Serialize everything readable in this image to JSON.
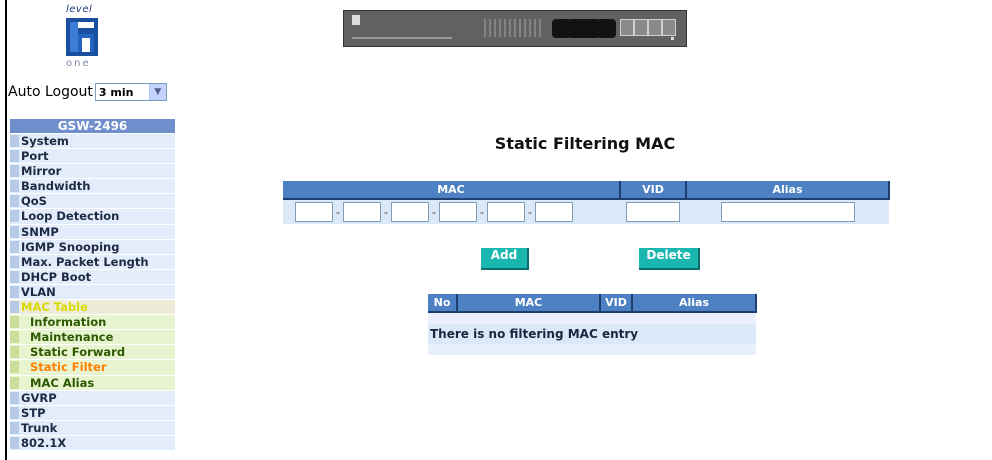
{
  "brand": {
    "top_text": "level",
    "bottom_text": "one"
  },
  "auto_logout": {
    "label": "Auto Logout",
    "value": "3 min"
  },
  "menu": {
    "title": "GSW-2496",
    "items": [
      {
        "label": "System"
      },
      {
        "label": "Port"
      },
      {
        "label": "Mirror"
      },
      {
        "label": "Bandwidth"
      },
      {
        "label": "QoS"
      },
      {
        "label": "Loop Detection"
      },
      {
        "label": "SNMP"
      },
      {
        "label": "IGMP Snooping"
      },
      {
        "label": "Max. Packet Length"
      },
      {
        "label": "DHCP Boot"
      },
      {
        "label": "VLAN"
      },
      {
        "label": "MAC Table"
      },
      {
        "label": "Information"
      },
      {
        "label": "Maintenance"
      },
      {
        "label": "Static Forward"
      },
      {
        "label": "Static Filter"
      },
      {
        "label": "MAC Alias"
      },
      {
        "label": "GVRP"
      },
      {
        "label": "STP"
      },
      {
        "label": "Trunk"
      },
      {
        "label": "802.1X"
      }
    ]
  },
  "main": {
    "title": "Static Filtering MAC",
    "entry_headers": {
      "mac": "MAC",
      "vid": "VID",
      "alias": "Alias"
    },
    "mac_separator": "-",
    "buttons": {
      "add": "Add",
      "delete": "Delete"
    },
    "list_headers": {
      "no": "No",
      "mac": "MAC",
      "vid": "VID",
      "alias": "Alias"
    },
    "empty_message": "There is no filtering MAC entry"
  }
}
